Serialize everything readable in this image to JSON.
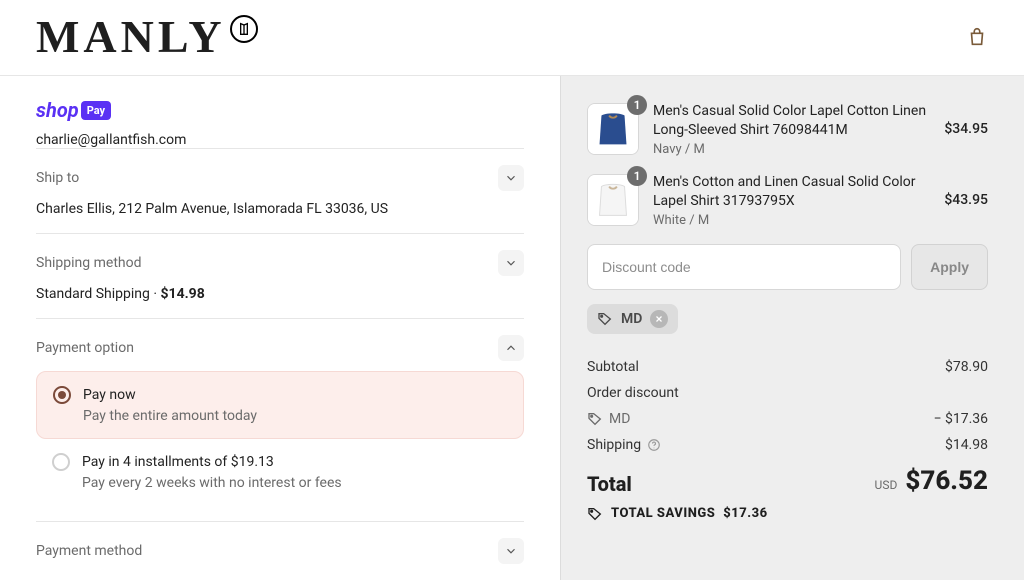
{
  "header": {
    "brand": "MANLY"
  },
  "account": {
    "email": "charlie@gallantfish.com"
  },
  "shipTo": {
    "label": "Ship to",
    "value": "Charles Ellis, 212 Palm Avenue, Islamorada FL 33036, US"
  },
  "shippingMethod": {
    "label": "Shipping method",
    "name": "Standard Shipping",
    "price": "$14.98"
  },
  "paymentOption": {
    "label": "Payment option",
    "options": [
      {
        "title": "Pay now",
        "subtitle": "Pay the entire amount today",
        "selected": true
      },
      {
        "title": "Pay in 4 installments of $19.13",
        "subtitle": "Pay every 2 weeks with no interest or fees",
        "selected": false
      }
    ]
  },
  "paymentMethod": {
    "label": "Payment method"
  },
  "cart": {
    "items": [
      {
        "qty": "1",
        "title": "Men's Casual Solid Color Lapel Cotton Linen Long-Sleeved Shirt 76098441M",
        "variant": "Navy / M",
        "price": "$34.95",
        "swatch": "navy"
      },
      {
        "qty": "1",
        "title": "Men's Cotton and Linen Casual Solid Color Lapel Shirt 31793795X",
        "variant": "White / M",
        "price": "$43.95",
        "swatch": "white"
      }
    ]
  },
  "discount": {
    "placeholder": "Discount code",
    "applyLabel": "Apply",
    "applied": {
      "code": "MD"
    }
  },
  "summary": {
    "subtotalLabel": "Subtotal",
    "subtotal": "$78.90",
    "orderDiscountLabel": "Order discount",
    "discountCode": "MD",
    "discountAmount": "− $17.36",
    "shippingLabel": "Shipping",
    "shipping": "$14.98",
    "totalLabel": "Total",
    "currency": "USD",
    "total": "$76.52",
    "savingsLabel": "TOTAL SAVINGS",
    "savings": "$17.36"
  }
}
